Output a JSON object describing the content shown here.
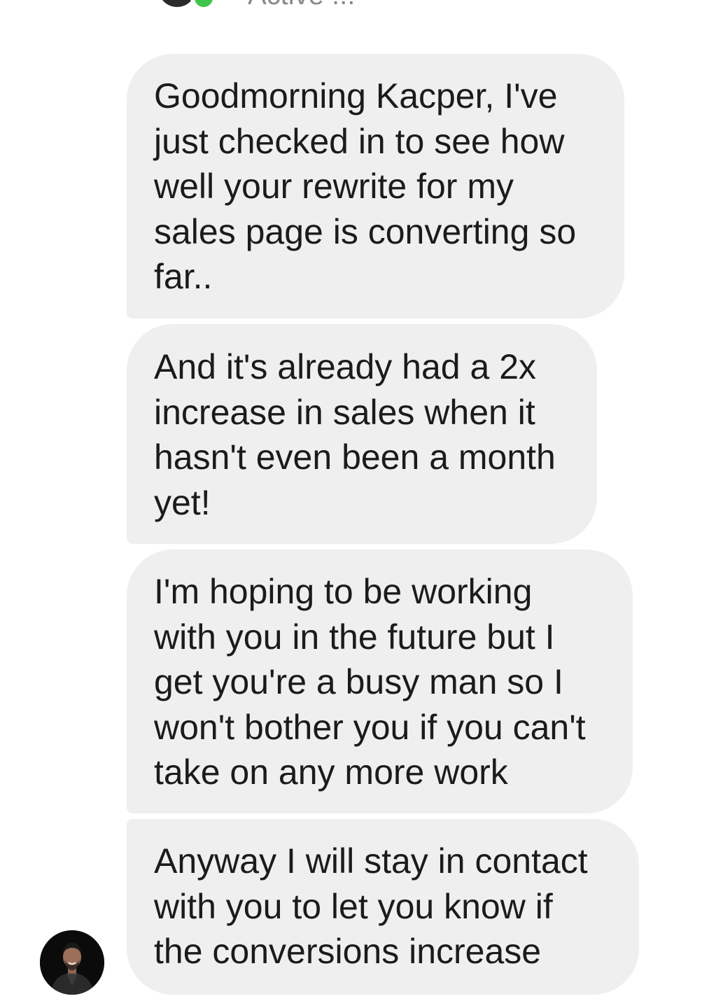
{
  "header": {
    "status": "Active ..."
  },
  "messages": [
    {
      "lines": [
        "Goodmorning Kacper, I've",
        "just checked in to see how",
        "well your rewrite for my",
        "sales page is converting so",
        "far.."
      ]
    },
    {
      "lines": [
        "And it's already had a 2x",
        "increase in sales when it",
        "hasn't even been a month",
        "yet!"
      ]
    },
    {
      "lines": [
        "I'm hoping to be working",
        "with you in the future but I",
        "get you're a busy man so I",
        "won't bother you if you can't",
        "take on any more work"
      ]
    },
    {
      "lines": [
        "Anyway I will stay in contact",
        "with you to let you know if",
        "the conversions increase"
      ]
    }
  ],
  "colors": {
    "bubble": "#efefef",
    "text": "#1b1b1b",
    "online": "#3fc64a",
    "status_text": "#8a8a8a"
  }
}
